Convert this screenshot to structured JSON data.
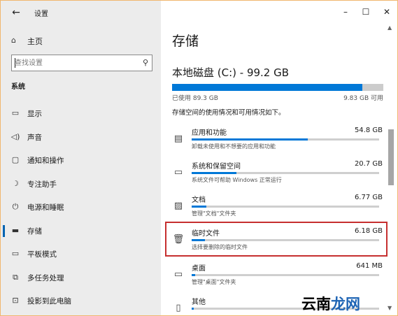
{
  "window": {
    "title": "设置",
    "back_icon": "back-arrow-icon",
    "controls": {
      "minimize": "–",
      "maximize": "☐",
      "close": "✕"
    }
  },
  "sidebar": {
    "home": {
      "icon": "home-icon",
      "label": "主页"
    },
    "search": {
      "placeholder": "查找设置",
      "icon": "search-icon"
    },
    "section": "系统",
    "items": [
      {
        "icon": "display-icon",
        "label": "显示"
      },
      {
        "icon": "sound-icon",
        "label": "声音"
      },
      {
        "icon": "notification-icon",
        "label": "通知和操作"
      },
      {
        "icon": "focus-assist-icon",
        "label": "专注助手"
      },
      {
        "icon": "power-icon",
        "label": "电源和睡眠"
      },
      {
        "icon": "storage-icon",
        "label": "存储",
        "active": true
      },
      {
        "icon": "tablet-icon",
        "label": "平板模式"
      },
      {
        "icon": "multitasking-icon",
        "label": "多任务处理"
      },
      {
        "icon": "project-icon",
        "label": "投影到此电脑"
      }
    ]
  },
  "main": {
    "page_title": "存储",
    "disk_title": "本地磁盘 (C:) - 99.2 GB",
    "usage_fraction": 0.9,
    "used_text": "已使用 89.3 GB",
    "free_text": "9.83 GB 可用",
    "description": "存储空间的使用情况和可用情况如下。",
    "categories": [
      {
        "icon": "apps-icon",
        "name": "应用和功能",
        "size": "54.8 GB",
        "fill": 0.62,
        "desc": "卸载未使用和不想要的应用和功能"
      },
      {
        "icon": "system-icon",
        "name": "系统和保留空间",
        "size": "20.7 GB",
        "fill": 0.24,
        "desc": "系统文件可帮助 Windows 正常运行"
      },
      {
        "icon": "documents-icon",
        "name": "文档",
        "size": "6.77 GB",
        "fill": 0.08,
        "desc": "管理\"文档\"文件夹"
      },
      {
        "icon": "trash-icon",
        "name": "临时文件",
        "size": "6.18 GB",
        "fill": 0.07,
        "desc": "选择要删除的临时文件",
        "highlight": true
      },
      {
        "icon": "desktop-icon",
        "name": "桌面",
        "size": "641 MB",
        "fill": 0.02,
        "desc": "管理\"桌面\"文件夹"
      },
      {
        "icon": "other-icon",
        "name": "其他",
        "size": "",
        "fill": 0.01,
        "desc": ""
      }
    ]
  },
  "watermark": {
    "part1": "云南",
    "part2": "龙网"
  }
}
